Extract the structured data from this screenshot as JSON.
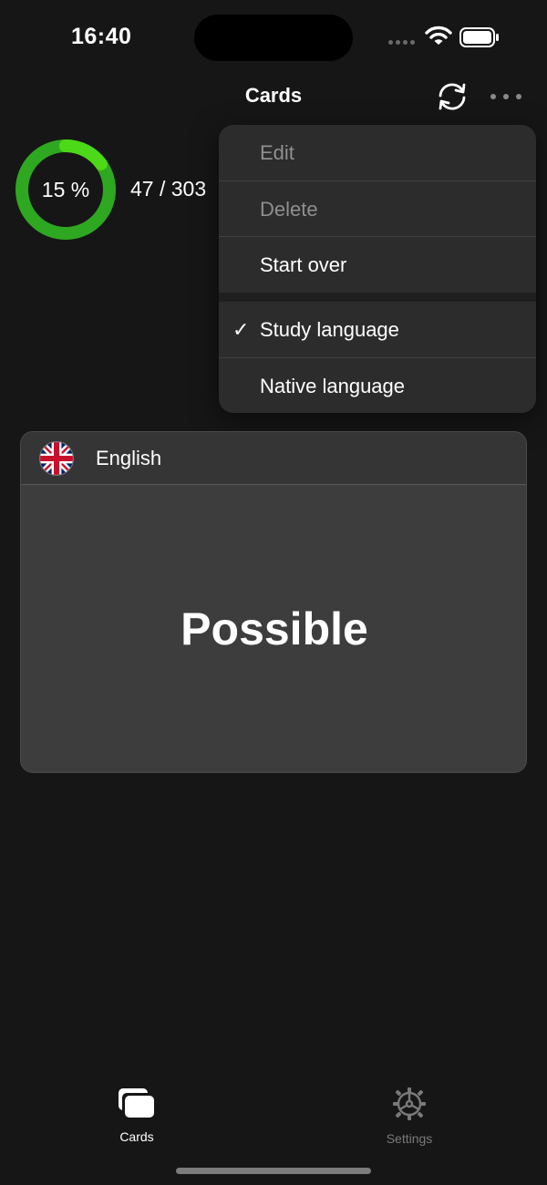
{
  "status_bar": {
    "time": "16:40"
  },
  "nav": {
    "title": "Cards",
    "sync_icon": "sync-icon",
    "more_icon": "ellipsis-icon"
  },
  "progress": {
    "percent_label": "15 %",
    "fraction": 0.15,
    "count_label": "47 / 303",
    "ring_color": "#2ea820",
    "ring_highlight_color": "#4cd917"
  },
  "menu": {
    "items": [
      {
        "label": "Edit",
        "enabled": false
      },
      {
        "label": "Delete",
        "enabled": false
      },
      {
        "label": "Start over",
        "enabled": true
      },
      {
        "label": "Study language",
        "enabled": true,
        "checked": true
      },
      {
        "label": "Native language",
        "enabled": true
      }
    ],
    "check_glyph": "✓"
  },
  "card": {
    "language": "English",
    "flag_icon": "uk-flag-icon",
    "word": "Possible"
  },
  "tab_bar": {
    "tabs": [
      {
        "label": "Cards",
        "icon": "cards-icon",
        "active": true
      },
      {
        "label": "Settings",
        "icon": "gear-icon",
        "active": false
      }
    ]
  }
}
